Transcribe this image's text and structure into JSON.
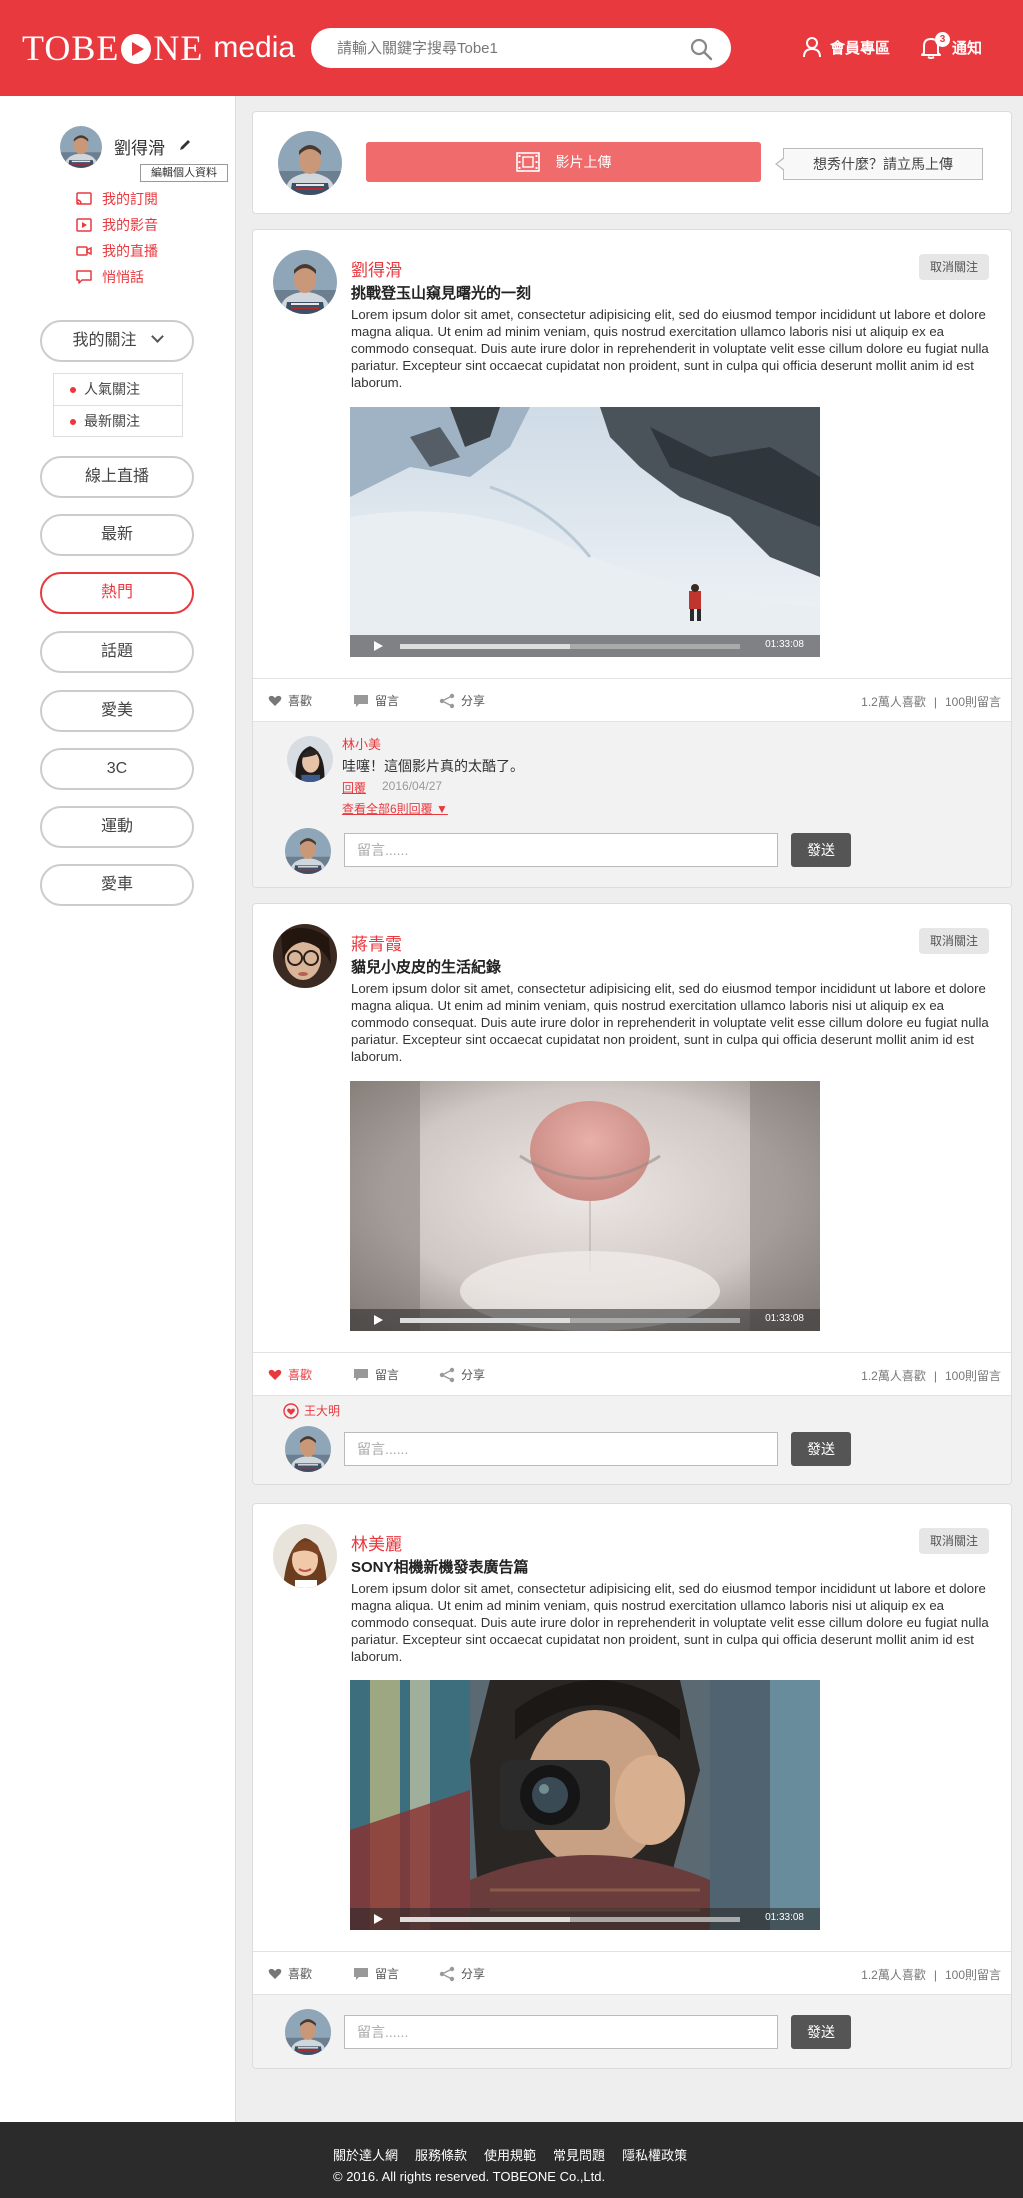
{
  "header": {
    "logo_word": "TOBE",
    "logo_word_2": "NE",
    "logo_media": "media",
    "search_placeholder": "請輸入關鍵字搜尋Tobe1",
    "member_label": "會員專區",
    "notify_label": "通知",
    "notify_count": "3",
    "brand_color": "#e8393f"
  },
  "sidebar": {
    "user_name": "劉得滑",
    "edit_profile": "編輯個人資料",
    "links": [
      {
        "label": "我的訂閱",
        "icon": "cast-icon"
      },
      {
        "label": "我的影音",
        "icon": "video-play-icon"
      },
      {
        "label": "我的直播",
        "icon": "camera-icon"
      },
      {
        "label": "悄悄話",
        "icon": "chat-icon"
      }
    ],
    "follow_menu": {
      "label": "我的關注",
      "options": [
        "人氣關注",
        "最新關注"
      ]
    },
    "categories": [
      "線上直播",
      "最新",
      "熱門",
      "話題",
      "愛美",
      "3C",
      "運動",
      "愛車"
    ],
    "active_category": "熱門"
  },
  "upload": {
    "button_label": "影片上傳",
    "tip": "想秀什麼？請立馬上傳"
  },
  "posts": [
    {
      "author": "劉得滑",
      "title": "挑戰登玉山窺見曙光的一刻",
      "body": "Lorem ipsum dolor sit amet, consectetur adipisicing elit, sed do eiusmod tempor incididunt ut labore et dolore magna aliqua. Ut enim ad minim veniam, quis nostrud exercitation ullamco laboris nisi ut aliquip ex ea commodo consequat. Duis aute irure dolor in reprehenderit in voluptate velit esse cillum dolore eu fugiat nulla pariatur. Excepteur sint occaecat cupidatat non proident, sunt in culpa qui officia deserunt mollit anim id est laborum.",
      "unfollow": "取消關注",
      "video_time": "01:33:08",
      "progress": 0.5,
      "like": "喜歡",
      "comment": "留言",
      "share": "分享",
      "likes_count": "1.2萬人喜歡",
      "comments_count": "100則留言",
      "liked": false,
      "comment_item": {
        "name": "林小美",
        "text": "哇噻！這個影片真的太酷了。",
        "reply": "回覆",
        "date": "2016/04/27",
        "more": "查看全部6則回覆 ▼"
      },
      "input_placeholder": "留言......",
      "send": "發送"
    },
    {
      "author": "蔣青霞",
      "title": "貓兒小皮皮的生活紀錄",
      "body": "Lorem ipsum dolor sit amet, consectetur adipisicing elit, sed do eiusmod tempor incididunt ut labore et dolore magna aliqua. Ut enim ad minim veniam, quis nostrud exercitation ullamco laboris nisi ut aliquip ex ea commodo consequat. Duis aute irure dolor in reprehenderit in voluptate velit esse cillum dolore eu fugiat nulla pariatur. Excepteur sint occaecat cupidatat non proident, sunt in culpa qui officia deserunt mollit anim id est laborum.",
      "unfollow": "取消關注",
      "video_time": "01:33:08",
      "progress": 0.5,
      "like": "喜歡",
      "comment": "留言",
      "share": "分享",
      "likes_count": "1.2萬人喜歡",
      "comments_count": "100則留言",
      "liked": true,
      "liker": "王大明",
      "input_placeholder": "留言......",
      "send": "發送"
    },
    {
      "author": "林美麗",
      "title": "SONY相機新機發表廣告篇",
      "body": "Lorem ipsum dolor sit amet, consectetur adipisicing elit, sed do eiusmod tempor incididunt ut labore et dolore magna aliqua. Ut enim ad minim veniam, quis nostrud exercitation ullamco laboris nisi ut aliquip ex ea commodo consequat. Duis aute irure dolor in reprehenderit in voluptate velit esse cillum dolore eu fugiat nulla pariatur. Excepteur sint occaecat cupidatat non proident, sunt in culpa qui officia deserunt mollit anim id est laborum.",
      "unfollow": "取消關注",
      "video_time": "01:33:08",
      "progress": 0.5,
      "like": "喜歡",
      "comment": "留言",
      "share": "分享",
      "likes_count": "1.2萬人喜歡",
      "comments_count": "100則留言",
      "liked": false,
      "input_placeholder": "留言......",
      "send": "發送"
    }
  ],
  "footer": {
    "links": [
      "關於達人網",
      "服務條款",
      "使用規範",
      "常見問題",
      "隱私權政策"
    ],
    "copyright": "© 2016. All rights reserved. TOBEONE Co.,Ltd."
  }
}
